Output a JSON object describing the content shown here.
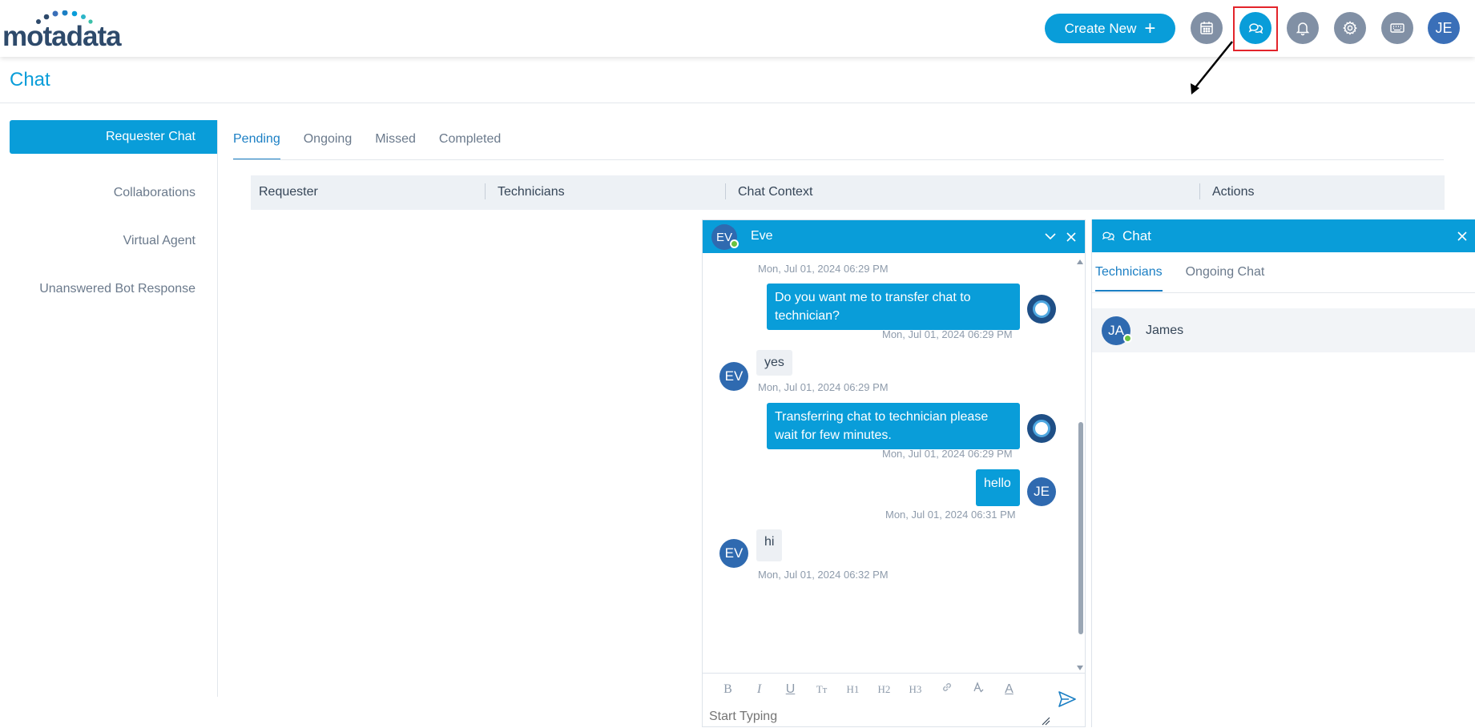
{
  "header": {
    "logo_text": "motadata",
    "create_new": "Create New",
    "create_plus": "+",
    "user_initials": "JE",
    "icons": [
      "calendar-icon",
      "chat-icon",
      "bell-icon",
      "gear-icon",
      "keyboard-icon"
    ],
    "accent": "#099dd9"
  },
  "page": {
    "title": "Chat"
  },
  "sidebar": {
    "items": [
      {
        "label": "Requester Chat"
      },
      {
        "label": "Collaborations"
      },
      {
        "label": "Virtual Agent"
      },
      {
        "label": "Unanswered Bot Response"
      }
    ]
  },
  "tabs": [
    "Pending",
    "Ongoing",
    "Missed",
    "Completed"
  ],
  "table": {
    "columns": [
      "Requester",
      "Technicians",
      "Chat Context",
      "Actions"
    ]
  },
  "chat_window": {
    "initials": "EV",
    "name": "Eve",
    "messages": [
      {
        "side": "left",
        "time": "Mon, Jul 01, 2024 06:29 PM"
      },
      {
        "side": "right",
        "text": "Do you want me to transfer chat to technician?",
        "time": "Mon, Jul 01, 2024 06:29 PM"
      },
      {
        "side": "left",
        "initials": "EV",
        "text": "yes",
        "time": "Mon, Jul 01, 2024 06:29 PM"
      },
      {
        "side": "right",
        "text": "Transferring chat to technician please wait for few minutes.",
        "time": "Mon, Jul 01, 2024 06:29 PM"
      },
      {
        "side": "right",
        "initials": "JE",
        "text": "hello",
        "time": "Mon, Jul 01, 2024 06:31 PM"
      },
      {
        "side": "left",
        "initials": "EV",
        "text": "hi",
        "time": "Mon, Jul 01, 2024 06:32 PM"
      }
    ],
    "toolbar": [
      "B",
      "I",
      "U",
      "Tт",
      "H1",
      "H2",
      "H3",
      "link-icon",
      "font-color-icon",
      "A"
    ],
    "placeholder": "Start Typing"
  },
  "chat_panel": {
    "title": "Chat",
    "tabs": [
      "Technicians",
      "Ongoing Chat"
    ],
    "technicians": [
      {
        "initials": "JA",
        "name": "James"
      }
    ]
  }
}
